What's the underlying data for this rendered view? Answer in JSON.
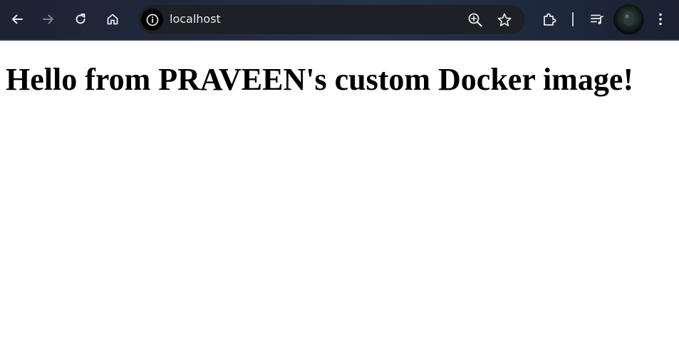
{
  "browser": {
    "url": "localhost",
    "icons": {
      "back": "arrow-left-icon",
      "forward": "arrow-right-icon",
      "reload": "reload-icon",
      "home": "home-icon",
      "site_info": "info-icon",
      "zoom": "zoom-in-icon",
      "bookmark": "star-icon",
      "extensions": "puzzle-icon",
      "media": "media-controls-icon",
      "menu": "kebab-menu-icon"
    },
    "colors": {
      "toolbar": "#20293d",
      "omnibox": "#1e2026",
      "icon": "#e8eaed",
      "icon_disabled": "#7b818c"
    }
  },
  "page": {
    "heading": "Hello from PRAVEEN's custom Docker image!"
  }
}
